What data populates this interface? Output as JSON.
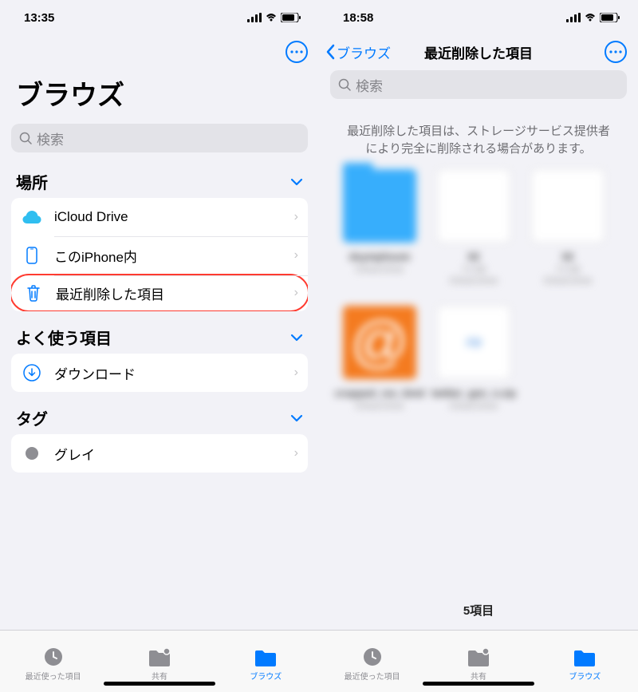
{
  "left": {
    "status": {
      "time": "13:35"
    },
    "title": "ブラウズ",
    "search_placeholder": "検索",
    "sections": {
      "locations": {
        "header": "場所",
        "items": [
          {
            "label": "iCloud Drive",
            "icon": "icloud"
          },
          {
            "label": "このiPhone内",
            "icon": "iphone"
          },
          {
            "label": "最近削除した項目",
            "icon": "trash",
            "highlight": true
          }
        ]
      },
      "favorites": {
        "header": "よく使う項目",
        "items": [
          {
            "label": "ダウンロード",
            "icon": "download"
          }
        ]
      },
      "tags": {
        "header": "タグ",
        "items": [
          {
            "label": "グレイ",
            "icon": "tag-gray"
          }
        ]
      }
    },
    "tabs": {
      "recent": "最近使った項目",
      "shared": "共有",
      "browse": "ブラウズ"
    }
  },
  "right": {
    "status": {
      "time": "18:58"
    },
    "back": "ブラウズ",
    "title": "最近削除した項目",
    "search_placeholder": "検索",
    "notice": "最近削除した項目は、ストレージサービス提供者により完全に削除される場合があります。",
    "items_count": "5項目",
    "tabs": {
      "recent": "最近使った項目",
      "shared": "共有",
      "browse": "ブラウズ"
    }
  }
}
